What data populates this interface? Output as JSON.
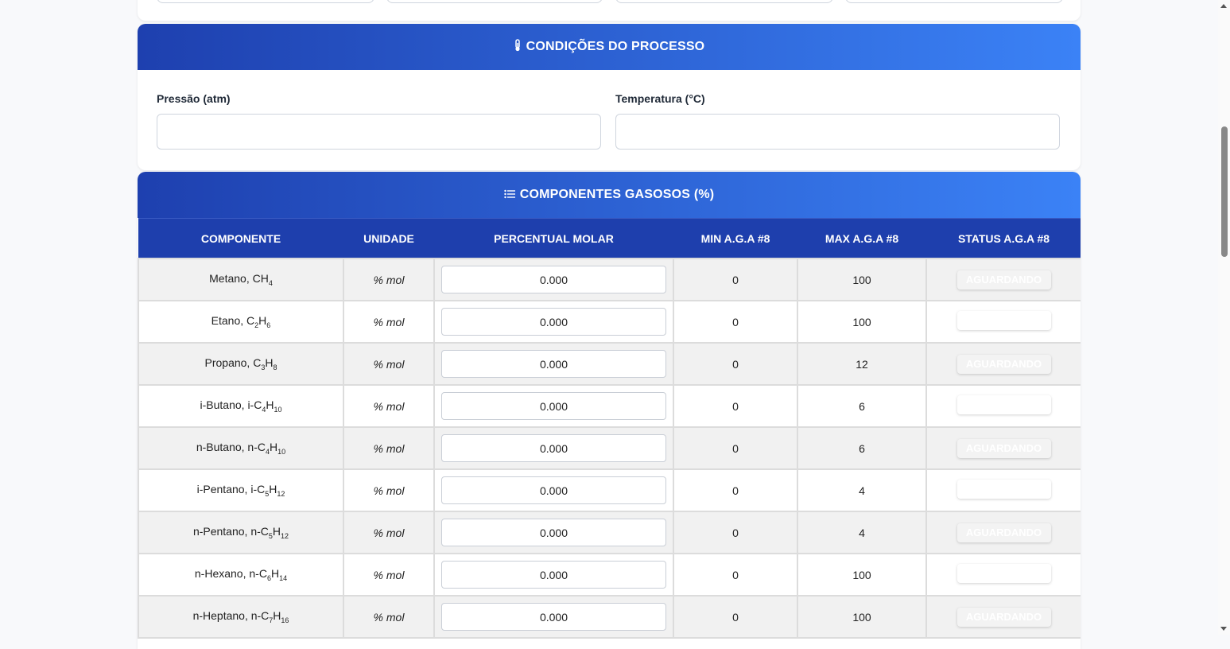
{
  "process_section": {
    "icon": "thermometer-icon",
    "title": "CONDIÇÕES DO PROCESSO",
    "pressure_label": "Pressão (atm)",
    "pressure_value": "",
    "temperature_label": "Temperatura (°C)",
    "temperature_value": ""
  },
  "components_section": {
    "icon": "list-icon",
    "title": "COMPONENTES GASOSOS (%)",
    "columns": [
      "COMPONENTE",
      "UNIDADE",
      "PERCENTUAL MOLAR",
      "MIN A.G.A #8",
      "MAX A.G.A #8",
      "STATUS A.G.A #8"
    ],
    "rows": [
      {
        "name": "Metano, CH",
        "sub": "4",
        "suffix": "",
        "unit": "% mol",
        "value": "0.000",
        "min": "0",
        "max": "100",
        "status": "AGUARDANDO"
      },
      {
        "name": "Etano, C",
        "sub": "2",
        "suffix": "H",
        "sub2": "6",
        "unit": "% mol",
        "value": "0.000",
        "min": "0",
        "max": "100",
        "status": ""
      },
      {
        "name": "Propano, C",
        "sub": "3",
        "suffix": "H",
        "sub2": "8",
        "unit": "% mol",
        "value": "0.000",
        "min": "0",
        "max": "12",
        "status": "AGUARDANDO"
      },
      {
        "name": "i-Butano, i-C",
        "sub": "4",
        "suffix": "H",
        "sub2": "10",
        "unit": "% mol",
        "value": "0.000",
        "min": "0",
        "max": "6",
        "status": ""
      },
      {
        "name": "n-Butano, n-C",
        "sub": "4",
        "suffix": "H",
        "sub2": "10",
        "unit": "% mol",
        "value": "0.000",
        "min": "0",
        "max": "6",
        "status": "AGUARDANDO"
      },
      {
        "name": "i-Pentano, i-C",
        "sub": "5",
        "suffix": "H",
        "sub2": "12",
        "unit": "% mol",
        "value": "0.000",
        "min": "0",
        "max": "4",
        "status": ""
      },
      {
        "name": "n-Pentano, n-C",
        "sub": "5",
        "suffix": "H",
        "sub2": "12",
        "unit": "% mol",
        "value": "0.000",
        "min": "0",
        "max": "4",
        "status": "AGUARDANDO"
      },
      {
        "name": "n-Hexano, n-C",
        "sub": "6",
        "suffix": "H",
        "sub2": "14",
        "unit": "% mol",
        "value": "0.000",
        "min": "0",
        "max": "100",
        "status": ""
      },
      {
        "name": "n-Heptano, n-C",
        "sub": "7",
        "suffix": "H",
        "sub2": "16",
        "unit": "% mol",
        "value": "0.000",
        "min": "0",
        "max": "100",
        "status": "AGUARDANDO"
      }
    ]
  },
  "colors": {
    "header_gradient_start": "#1e40af",
    "header_gradient_end": "#3b82f6",
    "table_header": "#1e3fad",
    "status_text": "#ffffff"
  }
}
